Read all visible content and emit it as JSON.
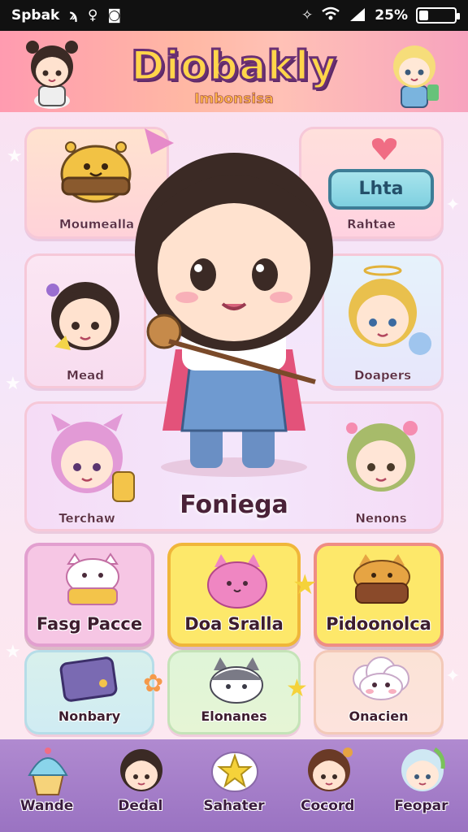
{
  "status_bar": {
    "carrier": "Spbak",
    "battery_text": "25%",
    "battery_level": 0.25
  },
  "header": {
    "title": "Diobakly",
    "subtitle": "Imbonsisa"
  },
  "hero": {
    "label": "Foniega",
    "pill_button": "Lhta"
  },
  "character_cards": [
    {
      "label": "Moumealla"
    },
    {
      "label": "Rahtae"
    },
    {
      "label": "Mead"
    },
    {
      "label": "Doapers"
    },
    {
      "label": "Terchaw"
    },
    {
      "label": "Nenons"
    }
  ],
  "tiles_row1": [
    {
      "label": "Fasg Pacce",
      "color": "#f6c6e4"
    },
    {
      "label": "Doa Sralla",
      "color": "#fde86a"
    },
    {
      "label": "Pidoonolca",
      "color": "#fde86a"
    }
  ],
  "tiles_row2": [
    {
      "label": "Nonbary"
    },
    {
      "label": "Elonanes"
    },
    {
      "label": "Onacien"
    }
  ],
  "bottom_nav": [
    {
      "label": "Wande",
      "icon": "cupcake-icon"
    },
    {
      "label": "Dedal",
      "icon": "girl-avatar-icon"
    },
    {
      "label": "Sahater",
      "icon": "star-bubble-icon"
    },
    {
      "label": "Cocord",
      "icon": "boy-avatar-icon"
    },
    {
      "label": "Feopar",
      "icon": "green-hair-avatar-icon"
    }
  ],
  "colors": {
    "header_accent": "#ff9bb0",
    "title_fill": "#ffd54a",
    "nav_bg": "#a680c8"
  }
}
